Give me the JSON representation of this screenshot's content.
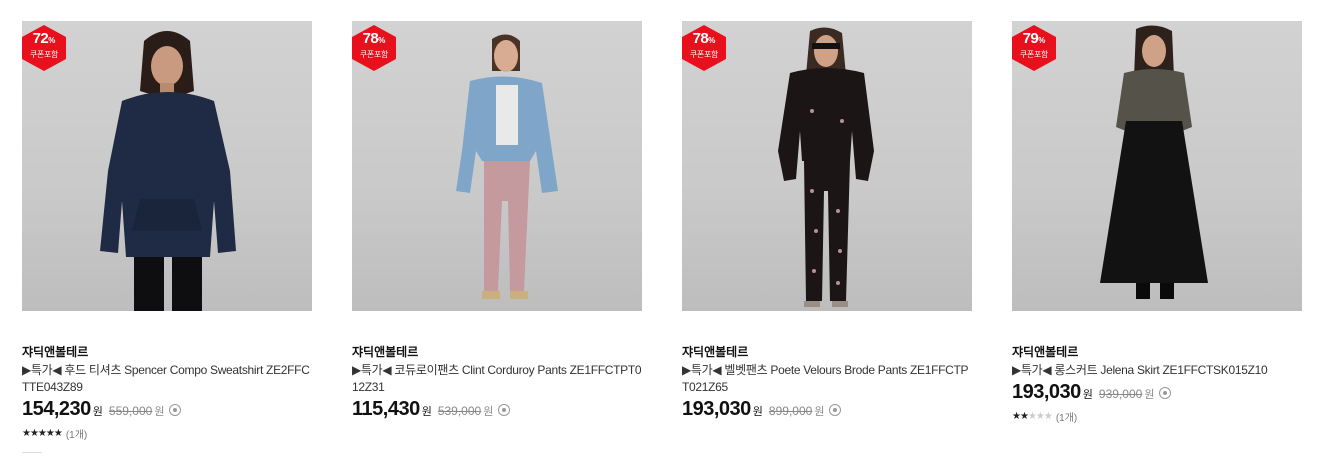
{
  "products": [
    {
      "badge_pct": "72",
      "badge_pct_unit": "%",
      "badge_coupon": "쿠폰포함",
      "brand": "쟈딕앤볼테르",
      "title": "▶특가◀ 후드 티셔츠 Spencer Compo Sweatshirt ZE2FFCTTE043Z89",
      "price": "154,230",
      "price_unit": "원",
      "original_price": "559,000",
      "original_unit": "원",
      "rating": 5,
      "rating_stars": "★★★★★",
      "review_count": "(1개)"
    },
    {
      "badge_pct": "78",
      "badge_pct_unit": "%",
      "badge_coupon": "쿠폰포함",
      "brand": "쟈딕앤볼테르",
      "title": "▶특가◀ 코듀로이팬츠 Clint Corduroy Pants ZE1FFCTPT012Z31",
      "price": "115,430",
      "price_unit": "원",
      "original_price": "539,000",
      "original_unit": "원"
    },
    {
      "badge_pct": "78",
      "badge_pct_unit": "%",
      "badge_coupon": "쿠폰포함",
      "brand": "쟈딕앤볼테르",
      "title": "▶특가◀ 벨벳팬츠 Poete Velours Brode Pants ZE1FFCTPT021Z65",
      "price": "193,030",
      "price_unit": "원",
      "original_price": "899,000",
      "original_unit": "원"
    },
    {
      "badge_pct": "79",
      "badge_pct_unit": "%",
      "badge_coupon": "쿠폰포함",
      "brand": "쟈딕앤볼테르",
      "title": "▶특가◀ 롱스커트 Jelena Skirt ZE1FFCTSK015Z10",
      "price": "193,030",
      "price_unit": "원",
      "original_price": "939,000",
      "original_unit": "원",
      "rating": 2,
      "rating_stars_on": "★★",
      "rating_stars_off": "★★★",
      "review_count": "(1개)"
    }
  ],
  "colors": {
    "badge_red": "#e8101c",
    "price_text": "#111111",
    "strike_text": "#888888"
  }
}
